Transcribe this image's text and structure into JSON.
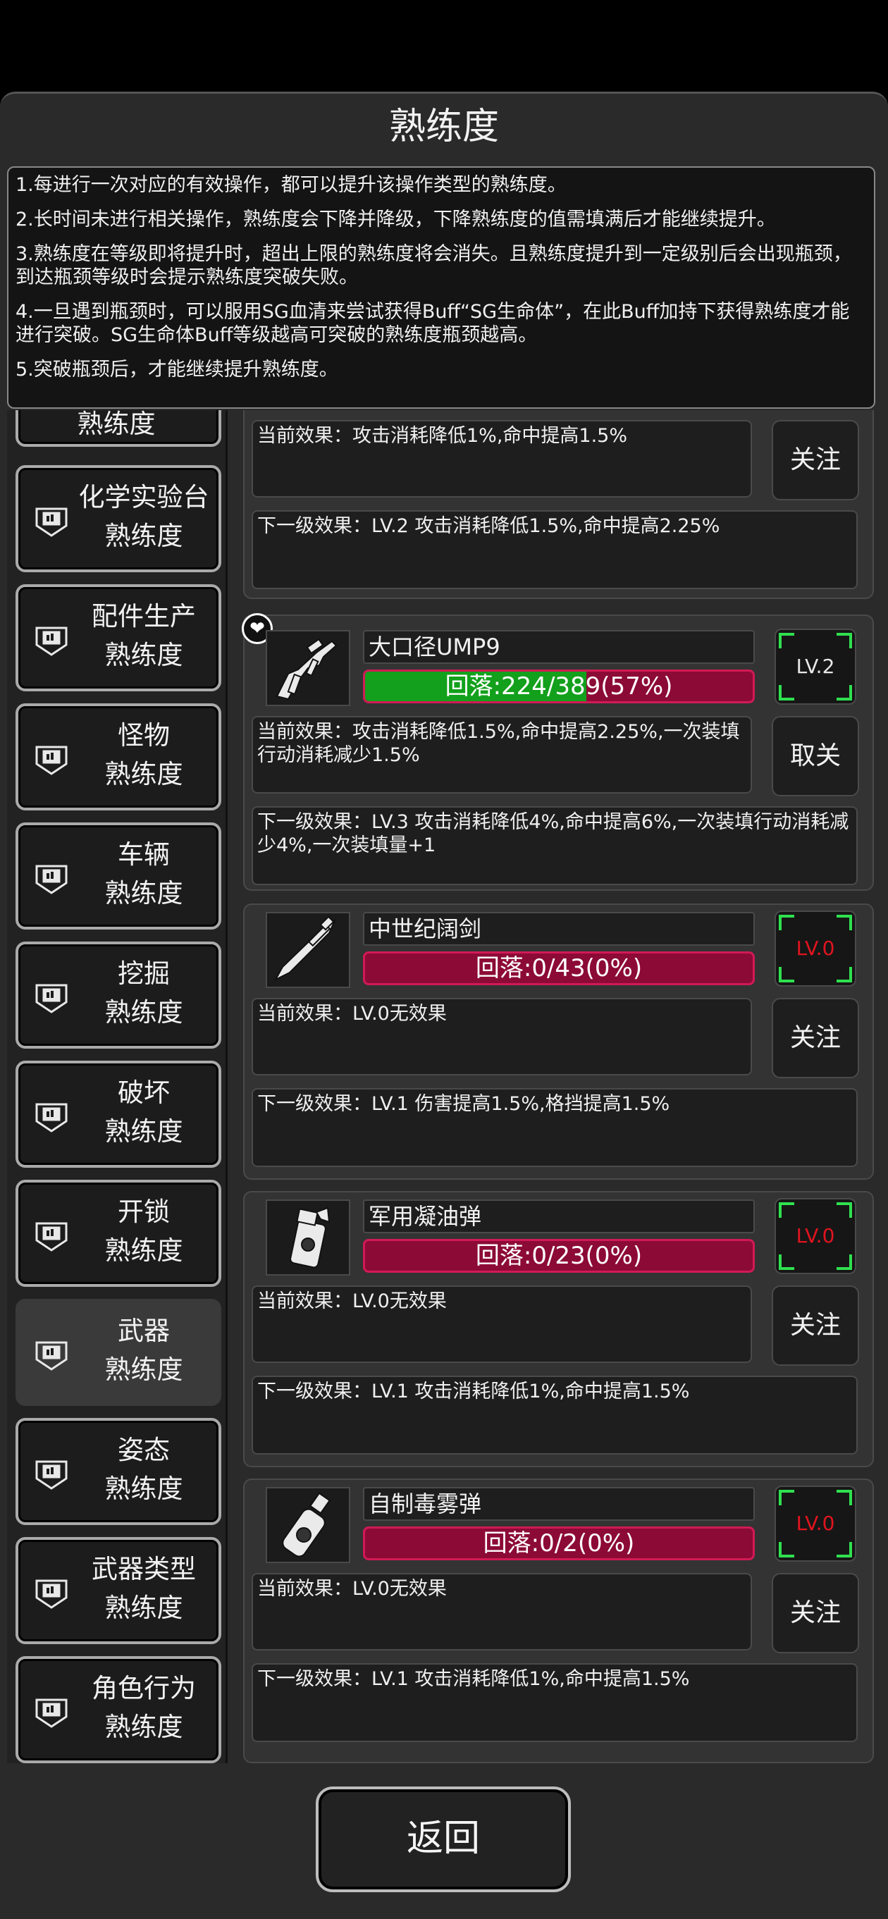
{
  "title": "熟练度",
  "info": [
    "1.每进行一次对应的有效操作，都可以提升该操作类型的熟练度。",
    "2.长时间未进行相关操作，熟练度会下降并降级，下降熟练度的值需填满后才能继续提升。",
    "3.熟练度在等级即将提升时，超出上限的熟练度将会消失。且熟练度提升到一定级别后会出现瓶颈，到达瓶颈等级时会提示熟练度突破失败。",
    "4.一旦遇到瓶颈时，可以服用SG血清来尝试获得Buff“SG生命体”，在此Buff加持下获得熟练度才能进行突破。SG生命体Buff等级越高可突破的熟练度瓶颈越高。",
    "5.突破瓶颈后，才能继续提升熟练度。"
  ],
  "sidebar": {
    "items": [
      {
        "line1": "化学实验台",
        "line2": "熟练度"
      },
      {
        "line1": "配件生产",
        "line2": "熟练度"
      },
      {
        "line1": "怪物",
        "line2": "熟练度"
      },
      {
        "line1": "车辆",
        "line2": "熟练度"
      },
      {
        "line1": "挖掘",
        "line2": "熟练度"
      },
      {
        "line1": "破坏",
        "line2": "熟练度"
      },
      {
        "line1": "开锁",
        "line2": "熟练度"
      },
      {
        "line1": "武器",
        "line2": "熟练度"
      },
      {
        "line1": "姿态",
        "line2": "熟练度"
      },
      {
        "line1": "武器类型",
        "line2": "熟练度"
      },
      {
        "line1": "角色行为",
        "line2": "熟练度"
      }
    ],
    "partial_top": "熟练度"
  },
  "cards": [
    {
      "current": "当前效果：攻击消耗降低1%,命中提高1.5%",
      "next": "下一级效果：LV.2 攻击消耗降低1.5%,命中提高2.25%",
      "button": "关注"
    },
    {
      "name": "大口径UMP9",
      "progress_text": "回落:224/389(57%)",
      "progress": 0.57,
      "level": "LV.2",
      "level_color": "#e8e8e8",
      "favorite": true,
      "current": "当前效果：攻击消耗降低1.5%,命中提高2.25%,一次装填行动消耗减少1.5%",
      "next": "下一级效果：LV.3 攻击消耗降低4%,命中提高6%,一次装填行动消耗减少4%,一次装填量+1",
      "button": "取关",
      "icon": "rifle-icon"
    },
    {
      "name": "中世纪阔剑",
      "progress_text": "回落:0/43(0%)",
      "progress": 0,
      "level": "LV.0",
      "level_color": "#e0141e",
      "current": "当前效果：LV.0无效果",
      "next": "下一级效果：LV.1 伤害提高1.5%,格挡提高1.5%",
      "button": "关注",
      "icon": "sword-icon"
    },
    {
      "name": "军用凝油弹",
      "progress_text": "回落:0/23(0%)",
      "progress": 0,
      "level": "LV.0",
      "level_color": "#e0141e",
      "current": "当前效果：LV.0无效果",
      "next": "下一级效果：LV.1 攻击消耗降低1%,命中提高1.5%",
      "button": "关注",
      "icon": "grenade-icon"
    },
    {
      "name": "自制毒雾弹",
      "progress_text": "回落:0/2(0%)",
      "progress": 0,
      "level": "LV.0",
      "level_color": "#e0141e",
      "current": "当前效果：LV.0无效果",
      "next": "下一级效果：LV.1 攻击消耗降低1%,命中提高1.5%",
      "button": "关注",
      "icon": "poison-bottle-icon"
    }
  ],
  "back_label": "返回"
}
